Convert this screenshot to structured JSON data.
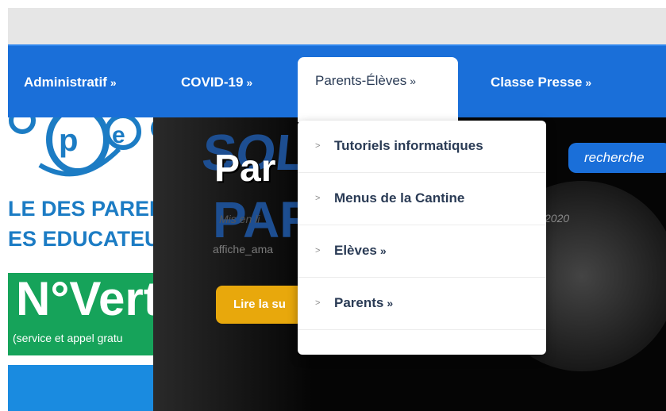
{
  "nav": {
    "items": [
      {
        "label": "Administratif",
        "arrow": "»"
      },
      {
        "label": "COVID-19",
        "arrow": "»"
      },
      {
        "label": "Parents-Élèves",
        "arrow": "»"
      },
      {
        "label": "Classe Presse",
        "arrow": "»"
      }
    ]
  },
  "dropdown": {
    "bullet": ">",
    "items": [
      {
        "label": "Tutoriels informatiques",
        "arrow": ""
      },
      {
        "label": "Menus de la Cantine",
        "arrow": ""
      },
      {
        "label": "Elèves",
        "arrow": "»"
      },
      {
        "label": "Parents",
        "arrow": "»"
      }
    ]
  },
  "logo": {
    "letters": [
      "p",
      "e"
    ],
    "line1": "LE DES PARENTS",
    "line2": "ES EDUCATEURS"
  },
  "banner": {
    "title": "N°Vert",
    "subtitle": "(service et appel gratu"
  },
  "hero": {
    "poster_top": "SOL",
    "poster_title": "Par",
    "poster_mid": "PAR",
    "poster_small": "Mis en li",
    "caption": "affiche_ama",
    "read_more": "Lire la su",
    "date": "2020"
  },
  "search": {
    "label": "recherche"
  },
  "colors": {
    "nav_blue": "#1a6fd9",
    "green": "#16a35a",
    "orange": "#e8a80c",
    "logo_blue": "#1c7cc4"
  }
}
